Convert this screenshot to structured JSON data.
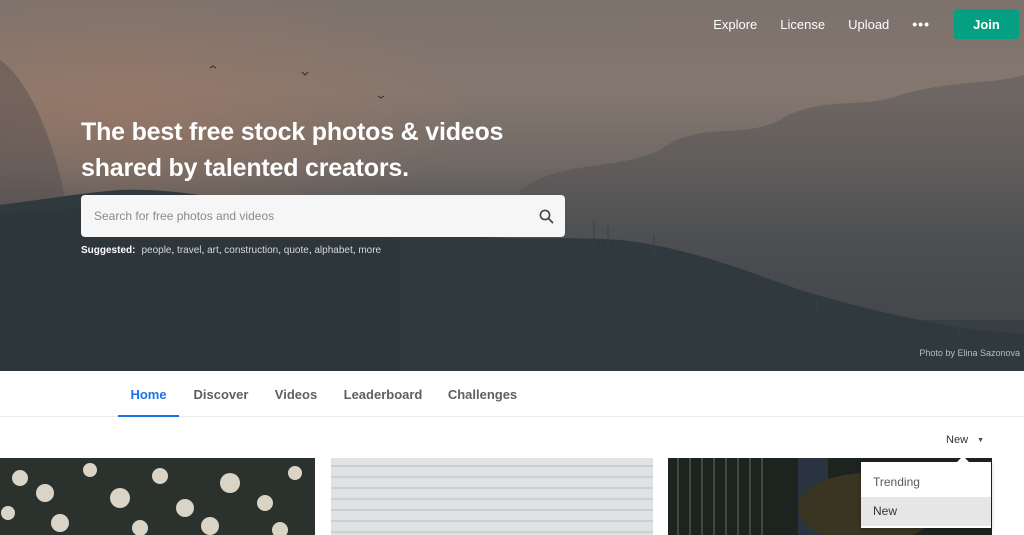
{
  "nav": {
    "links": [
      "Explore",
      "License",
      "Upload"
    ],
    "more_label": "•••",
    "join_label": "Join"
  },
  "hero": {
    "headline_line1": "The best free stock photos & videos",
    "headline_line2": "shared by talented creators.",
    "search_placeholder": "Search for free photos and videos",
    "search_value": "",
    "suggested_label": "Suggested:",
    "suggested_tags": [
      "people",
      "travel",
      "art",
      "construction",
      "quote",
      "alphabet",
      "more"
    ],
    "photo_credit": "Photo by Elina Sazonova"
  },
  "tabs": [
    {
      "label": "Home",
      "active": true
    },
    {
      "label": "Discover",
      "active": false
    },
    {
      "label": "Videos",
      "active": false
    },
    {
      "label": "Leaderboard",
      "active": false
    },
    {
      "label": "Challenges",
      "active": false
    }
  ],
  "sort": {
    "selected": "New",
    "options": [
      "Trending",
      "New"
    ]
  },
  "colors": {
    "accent": "#1a73e8",
    "join": "#05a081"
  }
}
